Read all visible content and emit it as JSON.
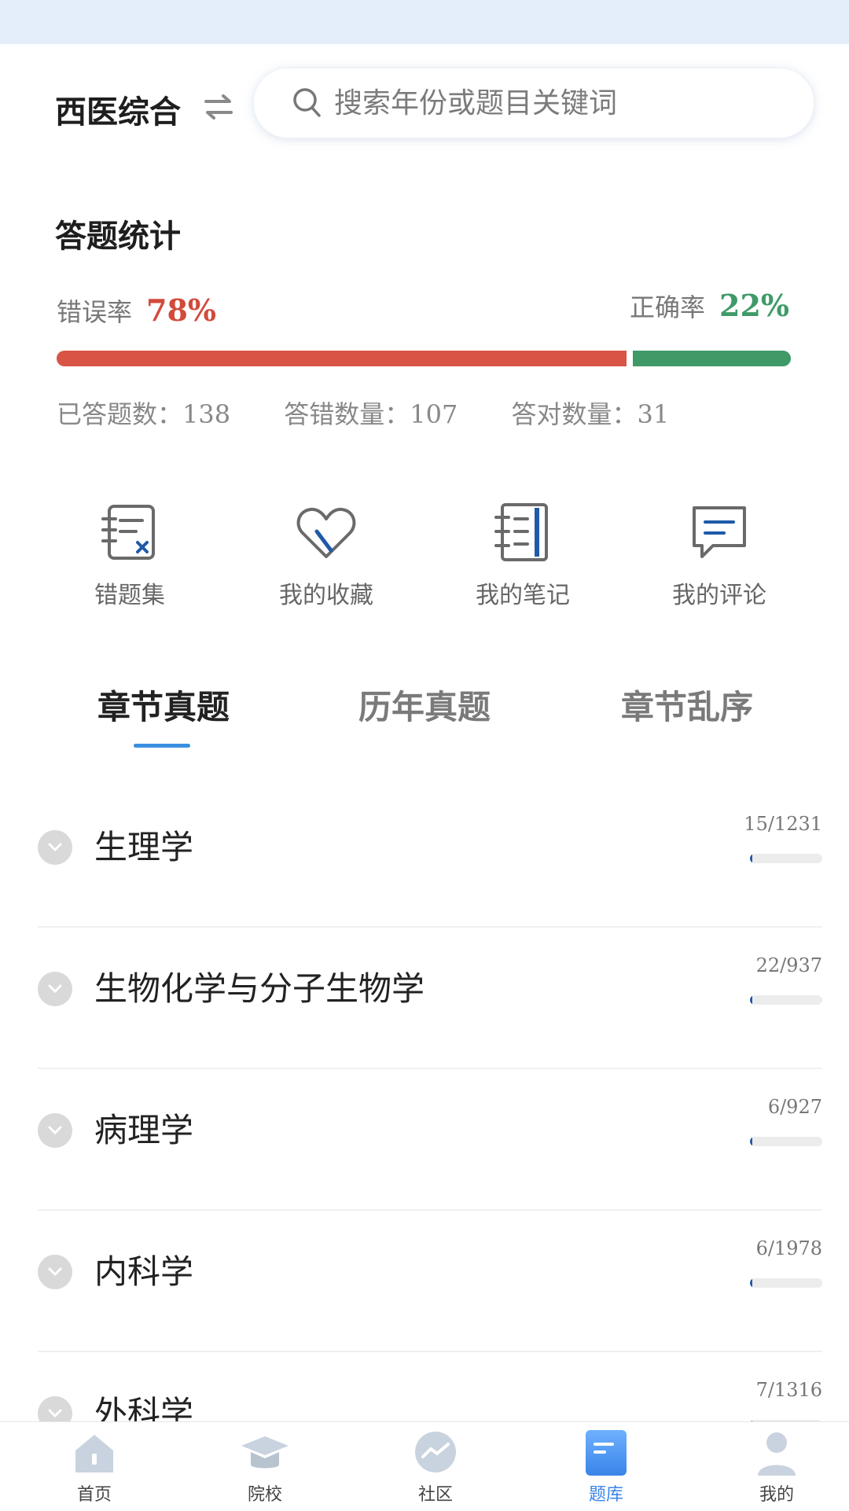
{
  "header": {
    "subject": "西医综合",
    "search_placeholder": "搜索年份或题目关键词"
  },
  "stats": {
    "title": "答题统计",
    "wrong_rate_label": "错误率",
    "wrong_rate": "78%",
    "right_rate_label": "正确率",
    "right_rate": "22%",
    "wrong_fraction": 0.78,
    "answered_label": "已答题数：",
    "answered": "138",
    "wrong_count_label": "答错数量：",
    "wrong_count": "107",
    "right_count_label": "答对数量：",
    "right_count": "31",
    "colors": {
      "wrong": "#d85444",
      "right": "#3f9a68"
    }
  },
  "shortcuts": [
    {
      "label": "错题集",
      "icon": "wrong-set-icon"
    },
    {
      "label": "我的收藏",
      "icon": "favorite-heart-icon"
    },
    {
      "label": "我的笔记",
      "icon": "notebook-icon"
    },
    {
      "label": "我的评论",
      "icon": "comment-icon"
    }
  ],
  "tabs": [
    {
      "label": "章节真题",
      "active": true
    },
    {
      "label": "历年真题",
      "active": false
    },
    {
      "label": "章节乱序",
      "active": false
    }
  ],
  "chapters": [
    {
      "name": "生理学",
      "progress": "15/1231",
      "done": 15,
      "total": 1231
    },
    {
      "name": "生物化学与分子生物学",
      "progress": "22/937",
      "done": 22,
      "total": 937
    },
    {
      "name": "病理学",
      "progress": "6/927",
      "done": 6,
      "total": 927
    },
    {
      "name": "内科学",
      "progress": "6/1978",
      "done": 6,
      "total": 1978
    },
    {
      "name": "外科学",
      "progress": "7/1316",
      "done": 7,
      "total": 1316
    }
  ],
  "tabbar": [
    {
      "label": "首页",
      "icon": "home-icon",
      "active": false
    },
    {
      "label": "院校",
      "icon": "graduation-cap-icon",
      "active": false
    },
    {
      "label": "社区",
      "icon": "community-icon",
      "active": false
    },
    {
      "label": "题库",
      "icon": "question-bank-icon",
      "active": true
    },
    {
      "label": "我的",
      "icon": "profile-icon",
      "active": false
    }
  ],
  "accent_color": "#3a8fe0"
}
